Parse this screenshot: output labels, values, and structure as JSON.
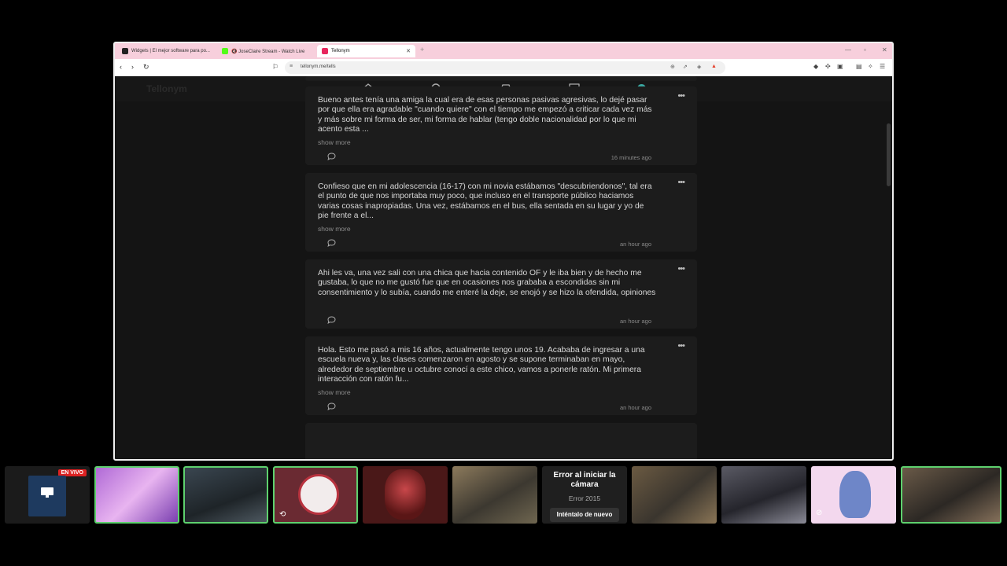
{
  "browser": {
    "tabs": [
      {
        "title": "Widgets | El mejor software para po...",
        "active": false
      },
      {
        "title": "🔇 JoseClaire Stream - Watch Live",
        "active": false
      },
      {
        "title": "Tellonym",
        "active": true
      }
    ],
    "url": "tellonym.me/tells"
  },
  "app": {
    "logo": "Tellonym",
    "nav_icons": [
      "home-icon",
      "search-icon",
      "inbox-icon",
      "chat-icon",
      "profile-avatar"
    ]
  },
  "tells": [
    {
      "text": "Bueno antes tenía una amiga la cual era de esas personas pasivas agresivas, lo dejé pasar por que ella era agradable \"cuando quiere\" con el tiempo me empezó a criticar cada vez más y más sobre mi forma de ser, mi forma de hablar (tengo doble nacionalidad por lo que mi acento esta ...",
      "more": "show more",
      "time": "16 minutes ago"
    },
    {
      "text": "Confieso que en mi adolescencia (16-17) con mi novia estábamos \"descubriendonos\", tal era el punto de que nos importaba muy poco, que incluso en el transporte público haciamos varias cosas inapropiadas. Una vez, estábamos en el bus, ella sentada en su lugar y yo de pie frente a el...",
      "more": "show more",
      "time": "an hour ago"
    },
    {
      "text": "Ahi les va, una vez sali con una chica que hacia contenido OF y le iba bien y de hecho me gustaba, lo que no me gustó fue que en ocasiones nos grababa a escondidas sin mi consentimiento y lo subía, cuando me enteré la deje, se enojó y se hizo la ofendida, opiniones",
      "more": "",
      "time": "an hour ago"
    },
    {
      "text": "Hola. Esto me pasó a mis 16 años, actualmente tengo unos 19. Acababa de ingresar a una escuela nueva y, las clases comenzaron en agosto y se supone terminaban en mayo, alrededor de septiembre u octubre conocí a este chico, vamos a ponerle ratón. Mi primera interacción con ratón fu...",
      "more": "show more",
      "time": "an hour ago"
    }
  ],
  "strip": {
    "live_badge": "EN VIVO",
    "error_title": "Error al iniciar la cámara",
    "error_code": "Error 2015",
    "retry_label": "Inténtalo de nuevo"
  },
  "colors": {
    "tabbar": "#f7cfdc",
    "page_bg": "#141414",
    "card_bg": "#1c1c1c",
    "avatar": "#3aa6a0",
    "live": "#dd2222",
    "active_border": "#5ed16e"
  }
}
